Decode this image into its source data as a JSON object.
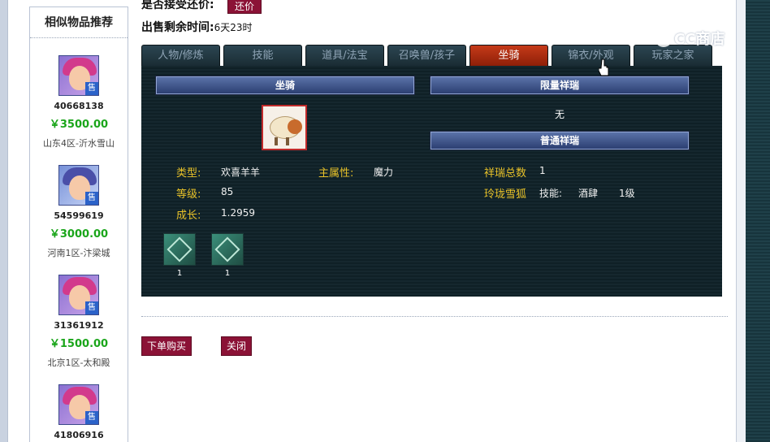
{
  "similar_panel": {
    "title": "相似物品推荐",
    "items": [
      {
        "id": "40668138",
        "price": "￥3500.00",
        "server": "山东4区-沂水雪山",
        "sell_badge": "售"
      },
      {
        "id": "54599619",
        "price": "￥3000.00",
        "server": "河南1区-汴梁城",
        "sell_badge": "售"
      },
      {
        "id": "31361912",
        "price": "￥1500.00",
        "server": "北京1区-太和殿",
        "sell_badge": "售"
      },
      {
        "id": "41806916",
        "price": "",
        "server": "",
        "sell_badge": "售"
      }
    ]
  },
  "header": {
    "accept_counter_label": "是否接受还价:",
    "counter_button": "还价",
    "time_left_label": "出售剩余时间:",
    "time_left_value": "6天23时"
  },
  "tabs": [
    {
      "label": "人物/修炼",
      "active": false
    },
    {
      "label": "技能",
      "active": false
    },
    {
      "label": "道具/法宝",
      "active": false
    },
    {
      "label": "召唤兽/孩子",
      "active": false
    },
    {
      "label": "坐骑",
      "active": true
    },
    {
      "label": "锦衣/外观",
      "active": false
    },
    {
      "label": "玩家之家",
      "active": false
    }
  ],
  "mount_panel": {
    "mount_header": "坐骑",
    "limited_header": "限量祥瑞",
    "limited_value": "无",
    "normal_header": "普通祥瑞",
    "attributes": {
      "type_label": "类型:",
      "type_value": "欢喜羊羊",
      "main_attr_label": "主属性:",
      "main_attr_value": "魔力",
      "level_label": "等级:",
      "level_value": "85",
      "growth_label": "成长:",
      "growth_value": "1.2959"
    },
    "xiangrui": {
      "total_label": "祥瑞总数",
      "total_value": "1",
      "fox_label": "玲珑雪狐",
      "fox_skill_label": "技能:",
      "fox_skill_name": "酒肆",
      "fox_skill_level": "1级"
    },
    "skills": [
      {
        "icon": "mount-skill-icon",
        "count": "1"
      },
      {
        "icon": "mount-skill-heart-icon",
        "count": "1"
      }
    ]
  },
  "actions": {
    "buy": "下单购买",
    "close": "关闭"
  },
  "watermark": "CC商店"
}
